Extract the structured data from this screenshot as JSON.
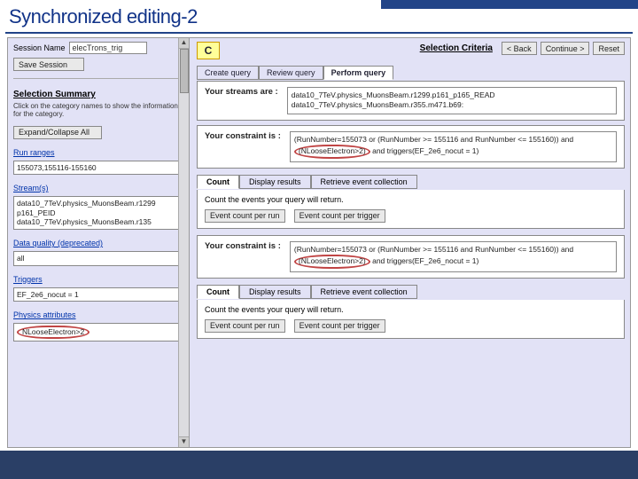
{
  "title": "Synchronized editing-2",
  "badge": "C",
  "header": {
    "selection_criteria": "Selection Criteria",
    "back": "< Back",
    "continue": "Continue >",
    "reset": "Reset"
  },
  "sidebar": {
    "session_name_label": "Session Name",
    "session_name_value": "elecTrons_trig",
    "save_session": "Save Session",
    "selection_summary_title": "Selection Summary",
    "selection_summary_sub": "Click on the category names to show the information for the category.",
    "expand_collapse": "Expand/Collapse All",
    "run_ranges_label": "Run ranges",
    "run_ranges_value": "155073,155116-155160",
    "streams_label": "Stream(s)",
    "streams_value": "data10_7TeV.physics_MuonsBeam.r1299\np161_PEID\ndata10_7TeV.physics_MuonsBeam.r135",
    "dq_label": "Data quality (deprecated)",
    "dq_value": "all",
    "triggers_label": "Triggers",
    "triggers_value": "EF_2e6_nocut = 1",
    "physics_attr_label": "Physics attributes",
    "physics_attr_value": "NLooseElectron>2"
  },
  "tabs": {
    "create": "Create query",
    "review": "Review query",
    "perform": "Perform query"
  },
  "streams_section": {
    "label": "Your streams are :",
    "lines": [
      "data10_7TeV.physics_MuonsBeam.r1299.p161_p165_READ",
      "data10_7TeV.physics_MuonsBeam.r355.m471.b69:"
    ]
  },
  "constraint1": {
    "label": "Your constraint is :",
    "text_a": "(RunNumber=155073 or (RunNumber >= 155116 and RunNumber <= 155160)) and ",
    "text_circ": "(NLooseElectron>2)",
    "text_b": " and triggers(EF_2e6_nocut = 1)"
  },
  "subtabs": {
    "count": "Count",
    "display": "Display results",
    "retrieve": "Retrieve event collection"
  },
  "count_section": {
    "desc": "Count the events your query will return.",
    "per_run": "Event count per run",
    "per_trigger": "Event count per trigger"
  },
  "constraint2": {
    "label": "Your constraint is :",
    "text_a": "(RunNumber=155073 or (RunNumber >= 155116 and RunNumber <= 155160)) and ",
    "text_circ": "(NLooseElectron>2)",
    "text_b": " and triggers(EF_2e6_nocut = 1)"
  }
}
